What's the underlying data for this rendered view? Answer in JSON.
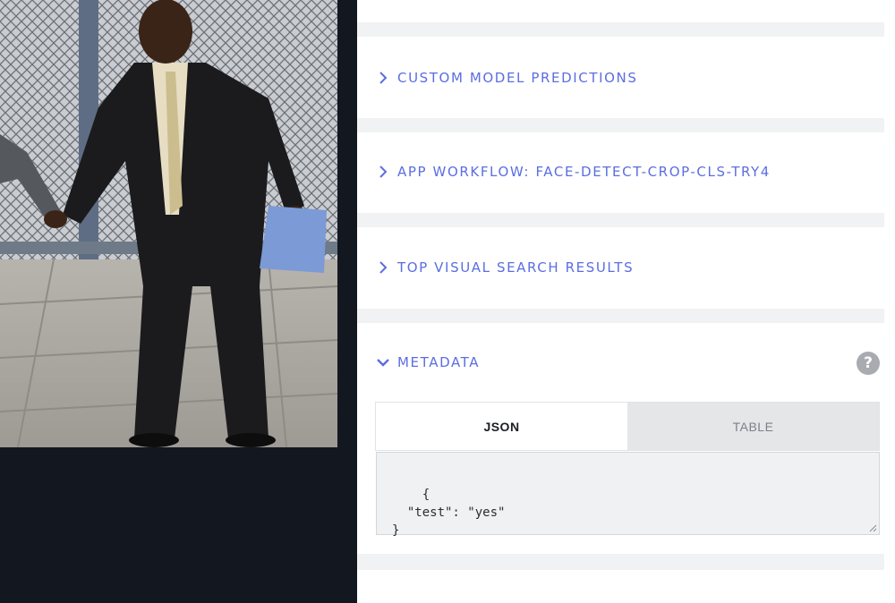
{
  "photo": {
    "description_icon": "photo-icon"
  },
  "panels": [
    {
      "title": "CUSTOM MODEL PREDICTIONS",
      "expanded": false
    },
    {
      "title": "APP WORKFLOW: FACE-DETECT-CROP-CLS-TRY4",
      "expanded": false
    },
    {
      "title": "TOP VISUAL SEARCH RESULTS",
      "expanded": false
    },
    {
      "title": "METADATA",
      "expanded": true
    }
  ],
  "metadata": {
    "help_icon": "?",
    "tabs": {
      "json": "JSON",
      "table": "TABLE"
    },
    "json_text": "{\n  \"test\": \"yes\"\n}"
  },
  "colors": {
    "accent": "#5b6ee1",
    "dark_pane": "#131820",
    "gap": "#f1f2f3"
  }
}
